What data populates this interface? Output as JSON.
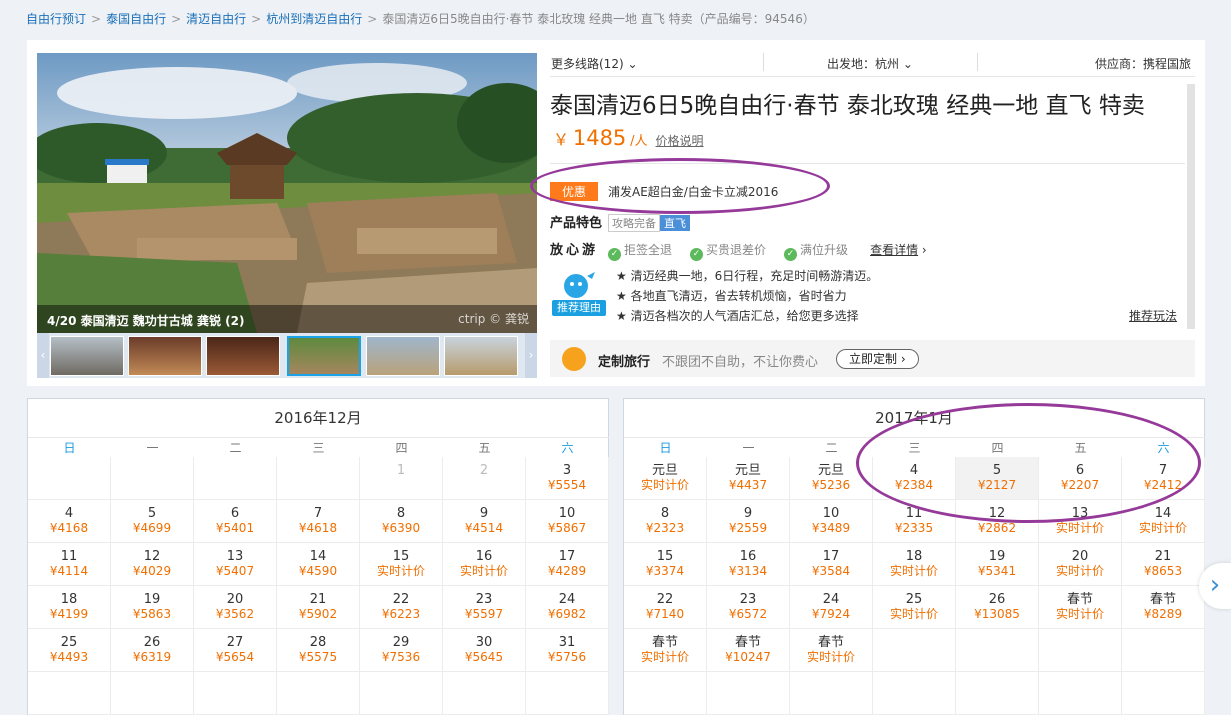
{
  "breadcrumb": {
    "items": [
      "自由行预订",
      "泰国自由行",
      "清迈自由行",
      "杭州到清迈自由行"
    ],
    "current": "泰国清迈6日5晚自由行·春节 泰北玫瑰 经典一地 直飞 特卖（产品编号：94546）"
  },
  "gallery": {
    "caption": "4/20 泰国清迈 魏功甘古城 龚锐 (2)",
    "watermark": "ctrip © 龚锐",
    "prev": "‹",
    "next": "›"
  },
  "meta": {
    "routes": "更多线路(12)",
    "departure": "出发地：杭州",
    "supplier": "供应商：携程国旅"
  },
  "product": {
    "title": "泰国清迈6日5晚自由行·春节 泰北玫瑰 经典一地 直飞 特卖",
    "currency": "￥",
    "price": "1485",
    "unit": "/人",
    "price_explain": "价格说明"
  },
  "promo": {
    "badge": "优惠",
    "text": "浦发AE超白金/白金卡立减2016"
  },
  "features": {
    "label": "产品特色",
    "tags": [
      "攻略完备",
      "直飞"
    ]
  },
  "assurance": {
    "label": "放心游",
    "items": [
      "拒签全退",
      "买贵退差价",
      "满位升级"
    ],
    "more": "查看详情",
    "arrow": "›"
  },
  "reasons": {
    "icon_label": "推荐理由",
    "items": [
      "★ 清迈经典一地，6日行程，充足时间畅游清迈。",
      "★ 各地直飞清迈，省去转机烦恼，省时省力",
      "★ 清迈各档次的人气酒店汇总，给您更多选择"
    ],
    "more": "推荐玩法"
  },
  "custom": {
    "title": "定制旅行",
    "slogan": "不跟团不自助，不让你费心",
    "button": "立即定制 ›"
  },
  "weekdays": [
    "日",
    "一",
    "二",
    "三",
    "四",
    "五",
    "六"
  ],
  "calendars": [
    {
      "title": "2016年12月",
      "rows": [
        [
          {
            "d": "",
            "p": ""
          },
          {
            "d": "",
            "p": ""
          },
          {
            "d": "",
            "p": ""
          },
          {
            "d": "",
            "p": ""
          },
          {
            "d": "1",
            "p": "",
            "g": true
          },
          {
            "d": "2",
            "p": "",
            "g": true
          },
          {
            "d": "3",
            "p": "¥5554"
          }
        ],
        [
          {
            "d": "4",
            "p": "¥4168"
          },
          {
            "d": "5",
            "p": "¥4699"
          },
          {
            "d": "6",
            "p": "¥5401"
          },
          {
            "d": "7",
            "p": "¥4618"
          },
          {
            "d": "8",
            "p": "¥6390"
          },
          {
            "d": "9",
            "p": "¥4514"
          },
          {
            "d": "10",
            "p": "¥5867"
          }
        ],
        [
          {
            "d": "11",
            "p": "¥4114"
          },
          {
            "d": "12",
            "p": "¥4029"
          },
          {
            "d": "13",
            "p": "¥5407"
          },
          {
            "d": "14",
            "p": "¥4590"
          },
          {
            "d": "15",
            "p": "实时计价"
          },
          {
            "d": "16",
            "p": "实时计价"
          },
          {
            "d": "17",
            "p": "¥4289"
          }
        ],
        [
          {
            "d": "18",
            "p": "¥4199"
          },
          {
            "d": "19",
            "p": "¥5863"
          },
          {
            "d": "20",
            "p": "¥3562"
          },
          {
            "d": "21",
            "p": "¥5902"
          },
          {
            "d": "22",
            "p": "¥6223"
          },
          {
            "d": "23",
            "p": "¥5597"
          },
          {
            "d": "24",
            "p": "¥6982"
          }
        ],
        [
          {
            "d": "25",
            "p": "¥4493"
          },
          {
            "d": "26",
            "p": "¥6319"
          },
          {
            "d": "27",
            "p": "¥5654"
          },
          {
            "d": "28",
            "p": "¥5575"
          },
          {
            "d": "29",
            "p": "¥7536"
          },
          {
            "d": "30",
            "p": "¥5645"
          },
          {
            "d": "31",
            "p": "¥5756"
          }
        ],
        [
          {
            "d": "",
            "p": ""
          },
          {
            "d": "",
            "p": ""
          },
          {
            "d": "",
            "p": ""
          },
          {
            "d": "",
            "p": ""
          },
          {
            "d": "",
            "p": ""
          },
          {
            "d": "",
            "p": ""
          },
          {
            "d": "",
            "p": ""
          }
        ]
      ]
    },
    {
      "title": "2017年1月",
      "rows": [
        [
          {
            "d": "元旦",
            "p": "实时计价"
          },
          {
            "d": "元旦",
            "p": "¥4437"
          },
          {
            "d": "元旦",
            "p": "¥5236"
          },
          {
            "d": "4",
            "p": "¥2384"
          },
          {
            "d": "5",
            "p": "¥2127",
            "h": true
          },
          {
            "d": "6",
            "p": "¥2207"
          },
          {
            "d": "7",
            "p": "¥2412"
          }
        ],
        [
          {
            "d": "8",
            "p": "¥2323"
          },
          {
            "d": "9",
            "p": "¥2559"
          },
          {
            "d": "10",
            "p": "¥3489"
          },
          {
            "d": "11",
            "p": "¥2335"
          },
          {
            "d": "12",
            "p": "¥2862"
          },
          {
            "d": "13",
            "p": "实时计价"
          },
          {
            "d": "14",
            "p": "实时计价"
          }
        ],
        [
          {
            "d": "15",
            "p": "¥3374"
          },
          {
            "d": "16",
            "p": "¥3134"
          },
          {
            "d": "17",
            "p": "¥3584"
          },
          {
            "d": "18",
            "p": "实时计价"
          },
          {
            "d": "19",
            "p": "¥5341"
          },
          {
            "d": "20",
            "p": "实时计价"
          },
          {
            "d": "21",
            "p": "¥8653"
          }
        ],
        [
          {
            "d": "22",
            "p": "¥7140"
          },
          {
            "d": "23",
            "p": "¥6572"
          },
          {
            "d": "24",
            "p": "¥7924"
          },
          {
            "d": "25",
            "p": "实时计价"
          },
          {
            "d": "26",
            "p": "¥13085"
          },
          {
            "d": "春节",
            "p": "实时计价"
          },
          {
            "d": "春节",
            "p": "¥8289"
          }
        ],
        [
          {
            "d": "春节",
            "p": "实时计价"
          },
          {
            "d": "春节",
            "p": "¥10247"
          },
          {
            "d": "春节",
            "p": "实时计价"
          },
          {
            "d": "",
            "p": ""
          },
          {
            "d": "",
            "p": ""
          },
          {
            "d": "",
            "p": ""
          },
          {
            "d": "",
            "p": ""
          }
        ],
        [
          {
            "d": "",
            "p": ""
          },
          {
            "d": "",
            "p": ""
          },
          {
            "d": "",
            "p": ""
          },
          {
            "d": "",
            "p": ""
          },
          {
            "d": "",
            "p": ""
          },
          {
            "d": "",
            "p": ""
          },
          {
            "d": "",
            "p": ""
          }
        ]
      ]
    }
  ],
  "next_month": "›",
  "colors": {
    "link": "#1a6fb8",
    "price": "#f06f00",
    "annotation": "#963a9a",
    "weekend": "#1a9be0"
  }
}
